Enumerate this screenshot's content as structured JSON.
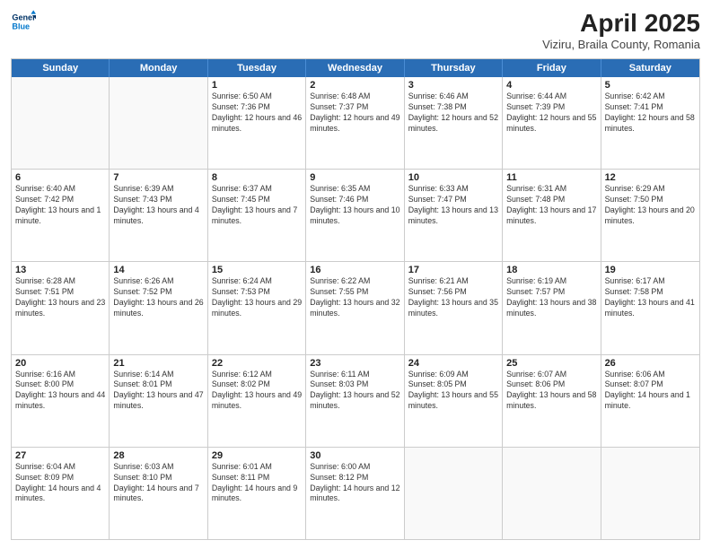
{
  "header": {
    "logo_line1": "General",
    "logo_line2": "Blue",
    "month": "April 2025",
    "location": "Viziru, Braila County, Romania"
  },
  "days_of_week": [
    "Sunday",
    "Monday",
    "Tuesday",
    "Wednesday",
    "Thursday",
    "Friday",
    "Saturday"
  ],
  "weeks": [
    [
      {
        "day": "",
        "empty": true
      },
      {
        "day": "",
        "empty": true
      },
      {
        "day": "1",
        "sunrise": "6:50 AM",
        "sunset": "7:36 PM",
        "daylight": "12 hours and 46 minutes."
      },
      {
        "day": "2",
        "sunrise": "6:48 AM",
        "sunset": "7:37 PM",
        "daylight": "12 hours and 49 minutes."
      },
      {
        "day": "3",
        "sunrise": "6:46 AM",
        "sunset": "7:38 PM",
        "daylight": "12 hours and 52 minutes."
      },
      {
        "day": "4",
        "sunrise": "6:44 AM",
        "sunset": "7:39 PM",
        "daylight": "12 hours and 55 minutes."
      },
      {
        "day": "5",
        "sunrise": "6:42 AM",
        "sunset": "7:41 PM",
        "daylight": "12 hours and 58 minutes."
      }
    ],
    [
      {
        "day": "6",
        "sunrise": "6:40 AM",
        "sunset": "7:42 PM",
        "daylight": "13 hours and 1 minute."
      },
      {
        "day": "7",
        "sunrise": "6:39 AM",
        "sunset": "7:43 PM",
        "daylight": "13 hours and 4 minutes."
      },
      {
        "day": "8",
        "sunrise": "6:37 AM",
        "sunset": "7:45 PM",
        "daylight": "13 hours and 7 minutes."
      },
      {
        "day": "9",
        "sunrise": "6:35 AM",
        "sunset": "7:46 PM",
        "daylight": "13 hours and 10 minutes."
      },
      {
        "day": "10",
        "sunrise": "6:33 AM",
        "sunset": "7:47 PM",
        "daylight": "13 hours and 13 minutes."
      },
      {
        "day": "11",
        "sunrise": "6:31 AM",
        "sunset": "7:48 PM",
        "daylight": "13 hours and 17 minutes."
      },
      {
        "day": "12",
        "sunrise": "6:29 AM",
        "sunset": "7:50 PM",
        "daylight": "13 hours and 20 minutes."
      }
    ],
    [
      {
        "day": "13",
        "sunrise": "6:28 AM",
        "sunset": "7:51 PM",
        "daylight": "13 hours and 23 minutes."
      },
      {
        "day": "14",
        "sunrise": "6:26 AM",
        "sunset": "7:52 PM",
        "daylight": "13 hours and 26 minutes."
      },
      {
        "day": "15",
        "sunrise": "6:24 AM",
        "sunset": "7:53 PM",
        "daylight": "13 hours and 29 minutes."
      },
      {
        "day": "16",
        "sunrise": "6:22 AM",
        "sunset": "7:55 PM",
        "daylight": "13 hours and 32 minutes."
      },
      {
        "day": "17",
        "sunrise": "6:21 AM",
        "sunset": "7:56 PM",
        "daylight": "13 hours and 35 minutes."
      },
      {
        "day": "18",
        "sunrise": "6:19 AM",
        "sunset": "7:57 PM",
        "daylight": "13 hours and 38 minutes."
      },
      {
        "day": "19",
        "sunrise": "6:17 AM",
        "sunset": "7:58 PM",
        "daylight": "13 hours and 41 minutes."
      }
    ],
    [
      {
        "day": "20",
        "sunrise": "6:16 AM",
        "sunset": "8:00 PM",
        "daylight": "13 hours and 44 minutes."
      },
      {
        "day": "21",
        "sunrise": "6:14 AM",
        "sunset": "8:01 PM",
        "daylight": "13 hours and 47 minutes."
      },
      {
        "day": "22",
        "sunrise": "6:12 AM",
        "sunset": "8:02 PM",
        "daylight": "13 hours and 49 minutes."
      },
      {
        "day": "23",
        "sunrise": "6:11 AM",
        "sunset": "8:03 PM",
        "daylight": "13 hours and 52 minutes."
      },
      {
        "day": "24",
        "sunrise": "6:09 AM",
        "sunset": "8:05 PM",
        "daylight": "13 hours and 55 minutes."
      },
      {
        "day": "25",
        "sunrise": "6:07 AM",
        "sunset": "8:06 PM",
        "daylight": "13 hours and 58 minutes."
      },
      {
        "day": "26",
        "sunrise": "6:06 AM",
        "sunset": "8:07 PM",
        "daylight": "14 hours and 1 minute."
      }
    ],
    [
      {
        "day": "27",
        "sunrise": "6:04 AM",
        "sunset": "8:09 PM",
        "daylight": "14 hours and 4 minutes."
      },
      {
        "day": "28",
        "sunrise": "6:03 AM",
        "sunset": "8:10 PM",
        "daylight": "14 hours and 7 minutes."
      },
      {
        "day": "29",
        "sunrise": "6:01 AM",
        "sunset": "8:11 PM",
        "daylight": "14 hours and 9 minutes."
      },
      {
        "day": "30",
        "sunrise": "6:00 AM",
        "sunset": "8:12 PM",
        "daylight": "14 hours and 12 minutes."
      },
      {
        "day": "",
        "empty": true
      },
      {
        "day": "",
        "empty": true
      },
      {
        "day": "",
        "empty": true
      }
    ]
  ]
}
